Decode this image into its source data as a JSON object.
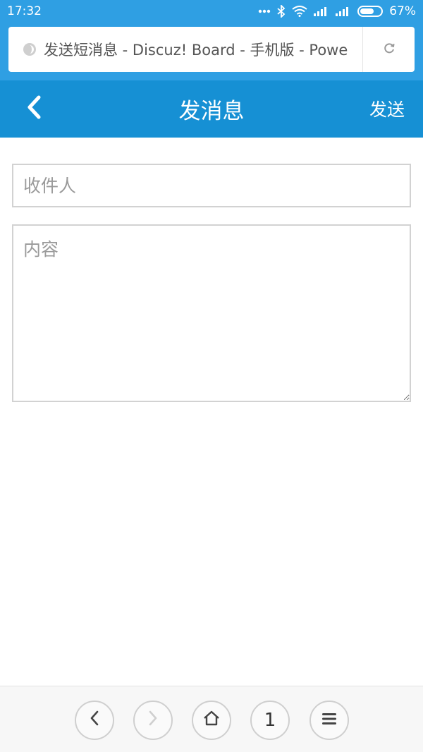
{
  "status_bar": {
    "time": "17:32",
    "battery_percent": "67%",
    "battery_level": 0.67,
    "icons": [
      "more-dots-icon",
      "bluetooth-icon",
      "wifi-icon",
      "signal-icon",
      "signal-icon",
      "battery-icon"
    ]
  },
  "browser": {
    "url_title": "发送短消息 - Discuz! Board - 手机版 - Powe",
    "site_icon": "site-icon",
    "refresh_icon": "refresh-icon"
  },
  "header": {
    "title": "发消息",
    "send_label": "发送",
    "back_icon": "chevron-left-icon"
  },
  "form": {
    "recipient_placeholder": "收件人",
    "recipient_value": "",
    "content_placeholder": "内容",
    "content_value": ""
  },
  "bottom_nav": {
    "tab_count": "1",
    "icons": [
      "chevron-left-icon",
      "chevron-right-icon",
      "home-icon",
      "tabs-icon",
      "menu-icon"
    ]
  },
  "colors": {
    "status_bar": "#2f9fe3",
    "header": "#1690d4",
    "input_border": "#d2d2d2",
    "placeholder": "#9a9a9a"
  }
}
